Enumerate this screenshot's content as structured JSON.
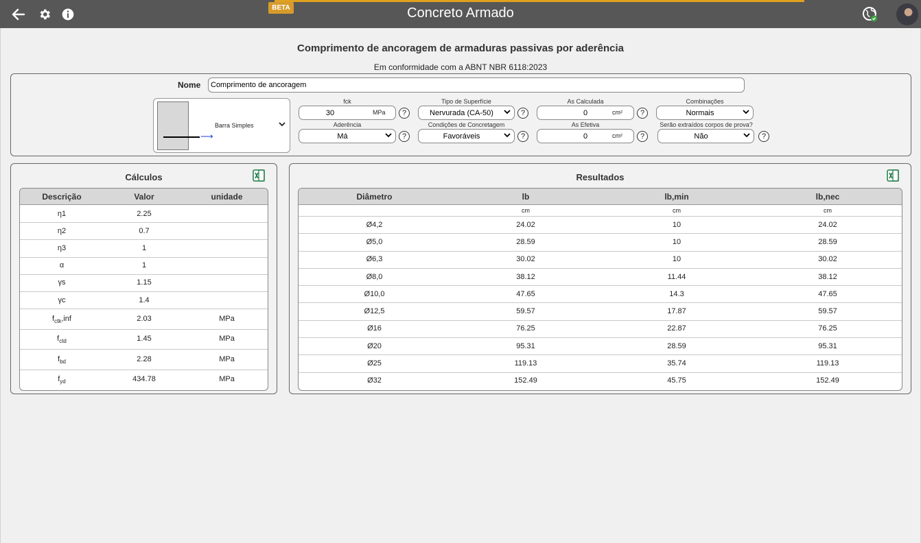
{
  "app": {
    "title": "Concreto Armado",
    "badge": "BETA"
  },
  "header": {
    "title": "Comprimento de ancoragem de armaduras passivas por aderência",
    "subtitle": "Em conformidade com a ABNT NBR 6118:2023"
  },
  "form": {
    "nome_label": "Nome",
    "nome_value": "Comprimento de ancoragem",
    "bar_type": "Barra Simples",
    "fck": {
      "label": "fck",
      "value": "30",
      "unit": "MPa"
    },
    "superficie": {
      "label": "Tipo de Superfície",
      "value": "Nervurada (CA-50)"
    },
    "as_calc": {
      "label": "As Calculada",
      "value": "0",
      "unit": "cm²"
    },
    "combinacoes": {
      "label": "Combinações",
      "value": "Normais"
    },
    "aderencia": {
      "label": "Aderência",
      "value": "Má"
    },
    "concretagem": {
      "label": "Condições de Concretagem",
      "value": "Favoráveis"
    },
    "as_ef": {
      "label": "As Efetiva",
      "value": "0",
      "unit": "cm²"
    },
    "corpos": {
      "label": "Serão extraídos corpos de prova?",
      "value": "Não"
    },
    "help_glyph": "?"
  },
  "calculos": {
    "title": "Cálculos",
    "headers": [
      "Descrição",
      "Valor",
      "unidade"
    ],
    "rows": [
      {
        "desc": "η1",
        "valor": "2.25",
        "unidade": ""
      },
      {
        "desc": "η2",
        "valor": "0.7",
        "unidade": ""
      },
      {
        "desc": "η3",
        "valor": "1",
        "unidade": ""
      },
      {
        "desc": "α",
        "valor": "1",
        "unidade": ""
      },
      {
        "desc": "γs",
        "valor": "1.15",
        "unidade": ""
      },
      {
        "desc": "γc",
        "valor": "1.4",
        "unidade": ""
      },
      {
        "desc_main": "f",
        "desc_sub": "ctk",
        "desc_tail": ",inf",
        "valor": "2.03",
        "unidade": "MPa"
      },
      {
        "desc_main": "f",
        "desc_sub": "ctd",
        "desc_tail": "",
        "valor": "1.45",
        "unidade": "MPa"
      },
      {
        "desc_main": "f",
        "desc_sub": "bd",
        "desc_tail": "",
        "valor": "2.28",
        "unidade": "MPa"
      },
      {
        "desc_main": "f",
        "desc_sub": "yd",
        "desc_tail": "",
        "valor": "434.78",
        "unidade": "MPa"
      }
    ]
  },
  "resultados": {
    "title": "Resultados",
    "headers": [
      "Diâmetro",
      "lb",
      "lb,min",
      "lb,nec"
    ],
    "units": [
      "",
      "cm",
      "cm",
      "cm"
    ],
    "rows": [
      [
        "Ø4,2",
        "24.02",
        "10",
        "24.02"
      ],
      [
        "Ø5,0",
        "28.59",
        "10",
        "28.59"
      ],
      [
        "Ø6,3",
        "30.02",
        "10",
        "30.02"
      ],
      [
        "Ø8,0",
        "38.12",
        "11.44",
        "38.12"
      ],
      [
        "Ø10,0",
        "47.65",
        "14.3",
        "47.65"
      ],
      [
        "Ø12,5",
        "59.57",
        "17.87",
        "59.57"
      ],
      [
        "Ø16",
        "76.25",
        "22.87",
        "76.25"
      ],
      [
        "Ø20",
        "95.31",
        "28.59",
        "95.31"
      ],
      [
        "Ø25",
        "119.13",
        "35.74",
        "119.13"
      ],
      [
        "Ø32",
        "152.49",
        "45.75",
        "152.49"
      ]
    ]
  },
  "icons": {
    "back": "arrow-left-icon",
    "settings": "gear-icon",
    "info": "info-icon",
    "globe": "globe-icon",
    "excel": "excel-icon"
  },
  "colors": {
    "topbar": "#575757",
    "accent": "#e0a020",
    "excel": "#1e7b45",
    "globe_badge": "#3aa540"
  }
}
